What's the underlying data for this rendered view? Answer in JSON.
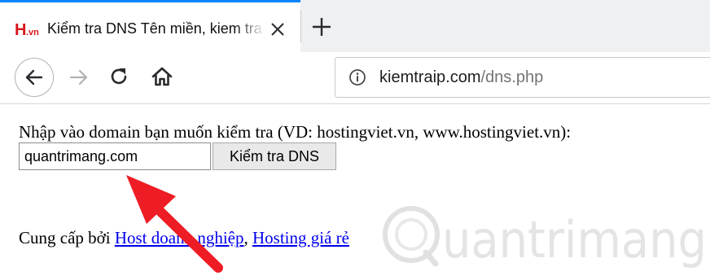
{
  "tab": {
    "favicon_text": "H.vn",
    "title": "Kiểm tra DNS Tên miền, kiem tra dns"
  },
  "address_bar": {
    "host": "kiemtraip.com",
    "path": "/dns.php"
  },
  "page": {
    "prompt": "Nhập vào domain bạn muốn kiểm tra (VD: hostingviet.vn, www.hostingviet.vn):",
    "domain_value": "quantrimang.com",
    "check_button": "Kiểm tra DNS",
    "provided_by": "Cung cấp bởi",
    "link_1": "Host doanh nghiệp",
    "separator": ",",
    "link_2": "Hosting giá rẻ"
  },
  "watermark": {
    "text": "uantrimang"
  },
  "colors": {
    "tab_accent": "#0a84ff",
    "link": "#0000ee",
    "arrow": "#ee1c24",
    "favicon_red": "#d7141a"
  },
  "icons": [
    "tab-favicon-icon",
    "close-icon",
    "plus-icon",
    "back-arrow-icon",
    "forward-arrow-icon",
    "reload-icon",
    "home-icon",
    "info-icon",
    "red-arrow-annotation"
  ]
}
